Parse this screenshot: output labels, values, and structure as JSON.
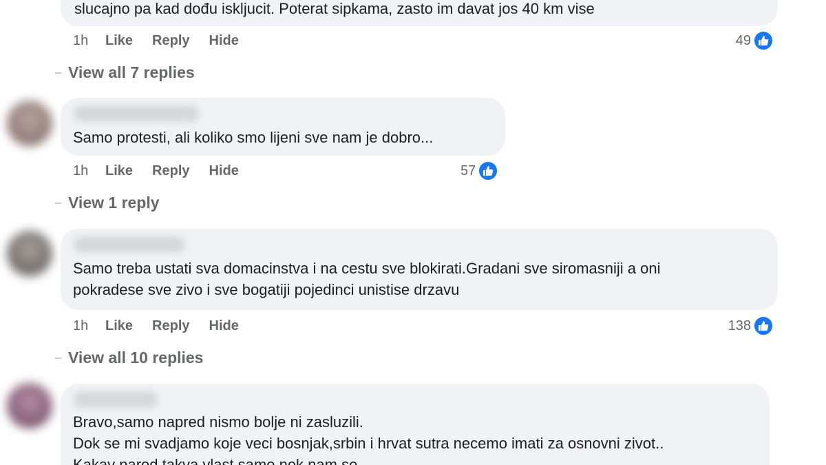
{
  "comments": [
    {
      "text": "slucajno pa kad dođu iskljucit. Poterat sipkama, zasto im davat jos 40 km vise",
      "time": "1h",
      "like_label": "Like",
      "reply_label": "Reply",
      "hide_label": "Hide",
      "reaction_count": "49",
      "reaction_icon": "thumbs-up-icon",
      "view_replies": "View all 7 replies"
    },
    {
      "text": "Samo protesti, ali koliko smo lijeni sve nam je dobro...",
      "time": "1h",
      "like_label": "Like",
      "reply_label": "Reply",
      "hide_label": "Hide",
      "reaction_count": "57",
      "reaction_icon": "thumbs-up-icon",
      "view_replies": "View 1 reply"
    },
    {
      "text": "Samo treba ustati sva domacinstva i na cestu sve blokirati.Gradani sve siromasniji a oni\npokradese sve zivo i sve bogatiji pojedinci unistise drzavu",
      "time": "1h",
      "like_label": "Like",
      "reply_label": "Reply",
      "hide_label": "Hide",
      "reaction_count": "138",
      "reaction_icon": "thumbs-up-icon",
      "view_replies": "View all 10 replies"
    },
    {
      "text": "Bravo,samo napred nismo bolje ni zasluzili.\nDok se mi svadjamo koje veci bosnjak,srbin i hrvat sutra necemo imati za osnovni zivot..\nKakav narod takva vlast samo nek nam se"
    }
  ],
  "colors": {
    "bubble": "#f0f2f5",
    "meta_text": "#65676b",
    "like_blue": "#1877f2"
  }
}
